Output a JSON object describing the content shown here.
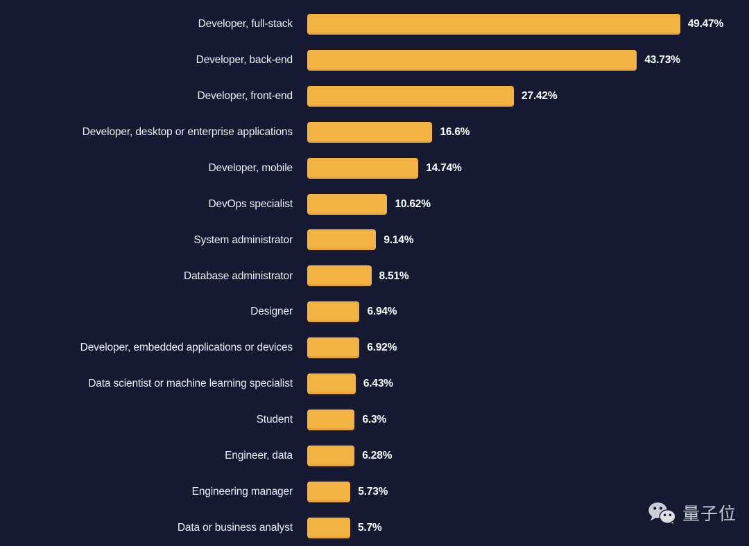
{
  "watermark": {
    "text": "量子位",
    "logo": "wechat-icon"
  },
  "chart_data": {
    "type": "bar",
    "orientation": "horizontal",
    "title": "",
    "subtitle": "",
    "xlabel": "",
    "ylabel": "",
    "grid": false,
    "legend": null,
    "xlim": [
      0,
      50
    ],
    "axis_visible": false,
    "value_suffix": "%",
    "bar_color": "#f2b342",
    "bar_edge_color": "#e9a735",
    "background_color": "#151a32",
    "label_color": "#eceff6",
    "value_color": "#ffffff",
    "categories": [
      "Developer, full-stack",
      "Developer, back-end",
      "Developer, front-end",
      "Developer, desktop or enterprise applications",
      "Developer, mobile",
      "DevOps specialist",
      "System administrator",
      "Database administrator",
      "Designer",
      "Developer, embedded applications or devices",
      "Data scientist or machine learning specialist",
      "Student",
      "Engineer, data",
      "Engineering manager",
      "Data or business analyst"
    ],
    "values": [
      49.47,
      43.73,
      27.42,
      16.6,
      14.74,
      10.62,
      9.14,
      8.51,
      6.94,
      6.92,
      6.43,
      6.3,
      6.28,
      5.73,
      5.7
    ],
    "value_labels": [
      "49.47%",
      "43.73%",
      "27.42%",
      "16.6%",
      "14.74%",
      "10.62%",
      "9.14%",
      "8.51%",
      "6.94%",
      "6.92%",
      "6.43%",
      "6.3%",
      "6.28%",
      "5.73%",
      "5.7%"
    ],
    "rows": [
      {
        "label": "Developer, full-stack",
        "value": 49.47,
        "value_label": "49.47%"
      },
      {
        "label": "Developer, back-end",
        "value": 43.73,
        "value_label": "43.73%"
      },
      {
        "label": "Developer, front-end",
        "value": 27.42,
        "value_label": "27.42%"
      },
      {
        "label": "Developer, desktop or enterprise applications",
        "value": 16.6,
        "value_label": "16.6%"
      },
      {
        "label": "Developer, mobile",
        "value": 14.74,
        "value_label": "14.74%"
      },
      {
        "label": "DevOps specialist",
        "value": 10.62,
        "value_label": "10.62%"
      },
      {
        "label": "System administrator",
        "value": 9.14,
        "value_label": "9.14%"
      },
      {
        "label": "Database administrator",
        "value": 8.51,
        "value_label": "8.51%"
      },
      {
        "label": "Designer",
        "value": 6.94,
        "value_label": "6.94%"
      },
      {
        "label": "Developer, embedded applications or devices",
        "value": 6.92,
        "value_label": "6.92%"
      },
      {
        "label": "Data scientist or machine learning specialist",
        "value": 6.43,
        "value_label": "6.43%"
      },
      {
        "label": "Student",
        "value": 6.3,
        "value_label": "6.3%"
      },
      {
        "label": "Engineer, data",
        "value": 6.28,
        "value_label": "6.28%"
      },
      {
        "label": "Engineering manager",
        "value": 5.73,
        "value_label": "5.73%"
      },
      {
        "label": "Data or business analyst",
        "value": 5.7,
        "value_label": "5.7%"
      }
    ]
  }
}
